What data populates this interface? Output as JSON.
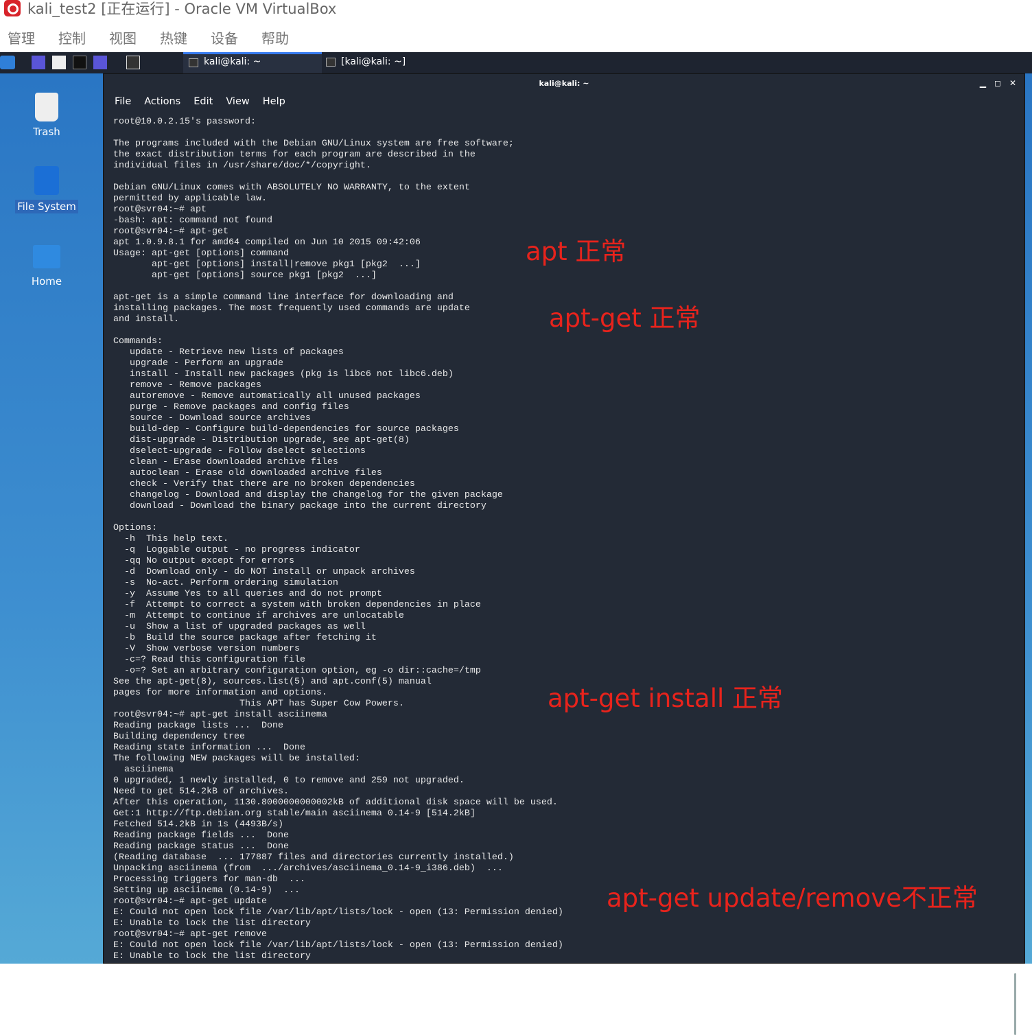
{
  "window": {
    "title": "kali_test2 [正在运行] - Oracle VM VirtualBox"
  },
  "menu": [
    "管理",
    "控制",
    "视图",
    "热键",
    "设备",
    "帮助"
  ],
  "taskbar": {
    "tabs": [
      "kali@kali: ~",
      "[kali@kali: ~]"
    ]
  },
  "desktop": {
    "icons": [
      "Trash",
      "File System",
      "Home"
    ]
  },
  "terminal": {
    "title": "kali@kali: ~",
    "menu": [
      "File",
      "Actions",
      "Edit",
      "View",
      "Help"
    ],
    "lines": [
      "root@10.0.2.15's password:",
      "",
      "The programs included with the Debian GNU/Linux system are free software;",
      "the exact distribution terms for each program are described in the",
      "individual files in /usr/share/doc/*/copyright.",
      "",
      "Debian GNU/Linux comes with ABSOLUTELY NO WARRANTY, to the extent",
      "permitted by applicable law.",
      "root@svr04:~# apt",
      "-bash: apt: command not found",
      "root@svr04:~# apt-get",
      "apt 1.0.9.8.1 for amd64 compiled on Jun 10 2015 09:42:06",
      "Usage: apt-get [options] command",
      "       apt-get [options] install|remove pkg1 [pkg2  ...]",
      "       apt-get [options] source pkg1 [pkg2  ...]",
      "",
      "apt-get is a simple command line interface for downloading and",
      "installing packages. The most frequently used commands are update",
      "and install.",
      "",
      "Commands:",
      "   update - Retrieve new lists of packages",
      "   upgrade - Perform an upgrade",
      "   install - Install new packages (pkg is libc6 not libc6.deb)",
      "   remove - Remove packages",
      "   autoremove - Remove automatically all unused packages",
      "   purge - Remove packages and config files",
      "   source - Download source archives",
      "   build-dep - Configure build-dependencies for source packages",
      "   dist-upgrade - Distribution upgrade, see apt-get(8)",
      "   dselect-upgrade - Follow dselect selections",
      "   clean - Erase downloaded archive files",
      "   autoclean - Erase old downloaded archive files",
      "   check - Verify that there are no broken dependencies",
      "   changelog - Download and display the changelog for the given package",
      "   download - Download the binary package into the current directory",
      "",
      "Options:",
      "  -h  This help text.",
      "  -q  Loggable output - no progress indicator",
      "  -qq No output except for errors",
      "  -d  Download only - do NOT install or unpack archives",
      "  -s  No-act. Perform ordering simulation",
      "  -y  Assume Yes to all queries and do not prompt",
      "  -f  Attempt to correct a system with broken dependencies in place",
      "  -m  Attempt to continue if archives are unlocatable",
      "  -u  Show a list of upgraded packages as well",
      "  -b  Build the source package after fetching it",
      "  -V  Show verbose version numbers",
      "  -c=? Read this configuration file",
      "  -o=? Set an arbitrary configuration option, eg -o dir::cache=/tmp",
      "See the apt-get(8), sources.list(5) and apt.conf(5) manual",
      "pages for more information and options.",
      "                       This APT has Super Cow Powers.",
      "root@svr04:~# apt-get install asciinema",
      "Reading package lists ...  Done",
      "Building dependency tree",
      "Reading state information ...  Done",
      "The following NEW packages will be installed:",
      "  asciinema",
      "0 upgraded, 1 newly installed, 0 to remove and 259 not upgraded.",
      "Need to get 514.2kB of archives.",
      "After this operation, 1130.8000000000002kB of additional disk space will be used.",
      "Get:1 http://ftp.debian.org stable/main asciinema 0.14-9 [514.2kB]",
      "Fetched 514.2kB in 1s (4493B/s)",
      "Reading package fields ...  Done",
      "Reading package status ...  Done",
      "(Reading database  ... 177887 files and directories currently installed.)",
      "Unpacking asciinema (from  .../archives/asciinema_0.14-9_i386.deb)  ...",
      "Processing triggers for man-db  ...",
      "Setting up asciinema (0.14-9)  ...",
      "root@svr04:~# apt-get update",
      "E: Could not open lock file /var/lib/apt/lists/lock - open (13: Permission denied)",
      "E: Unable to lock the list directory",
      "root@svr04:~# apt-get remove",
      "E: Could not open lock file /var/lib/apt/lists/lock - open (13: Permission denied)",
      "E: Unable to lock the list directory"
    ]
  },
  "annotations": [
    "apt 正常",
    "apt-get 正常",
    "apt-get install 正常",
    "apt-get update/remove不正常"
  ],
  "colors": {
    "annotation": "#e8231c",
    "terminal_bg": "#232a36",
    "accent": "#367bf0"
  }
}
